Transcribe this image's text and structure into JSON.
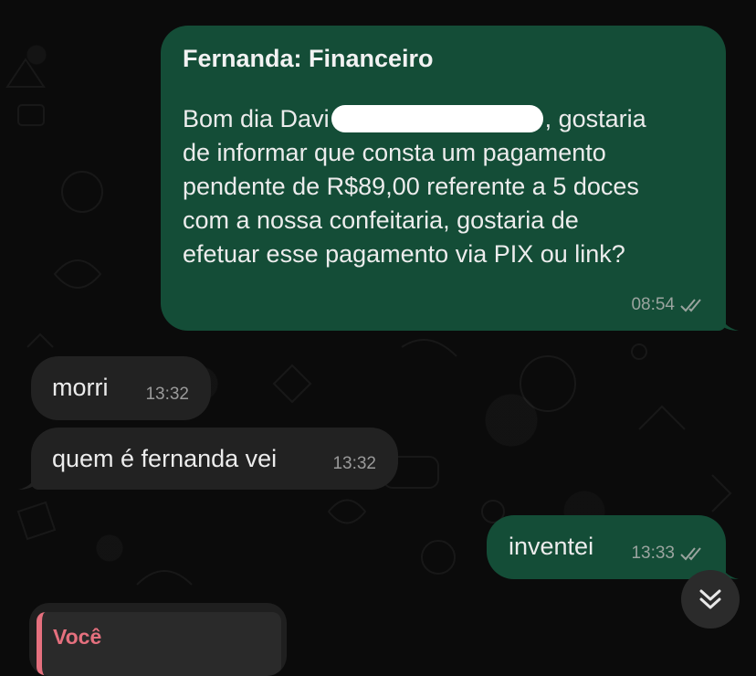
{
  "messages": [
    {
      "direction": "outgoing",
      "sender_title": "Fernanda: Financeiro",
      "line1_before": "Bom dia Davi",
      "line1_after": ", gostaria",
      "line2": "de informar que consta um pagamento",
      "line3": "pendente de R$89,00 referente a 5 doces",
      "line4": "com a nossa confeitaria, gostaria de",
      "line5": "efetuar esse pagamento via PIX ou link?",
      "time": "08:54",
      "status": "read"
    },
    {
      "direction": "incoming",
      "text": "morri",
      "time": "13:32"
    },
    {
      "direction": "incoming",
      "text": "quem é fernanda vei",
      "time": "13:32"
    },
    {
      "direction": "outgoing",
      "text": "inventei",
      "time": "13:33",
      "status": "read"
    }
  ],
  "reply_preview": {
    "author": "Você"
  },
  "icons": {
    "read_receipt": "double-check-icon",
    "scroll_down": "chevron-double-down-icon"
  },
  "colors": {
    "outgoing_bubble": "#144d37",
    "incoming_bubble": "#222222",
    "background": "#0b0b0b",
    "reply_accent": "#e5707e"
  }
}
